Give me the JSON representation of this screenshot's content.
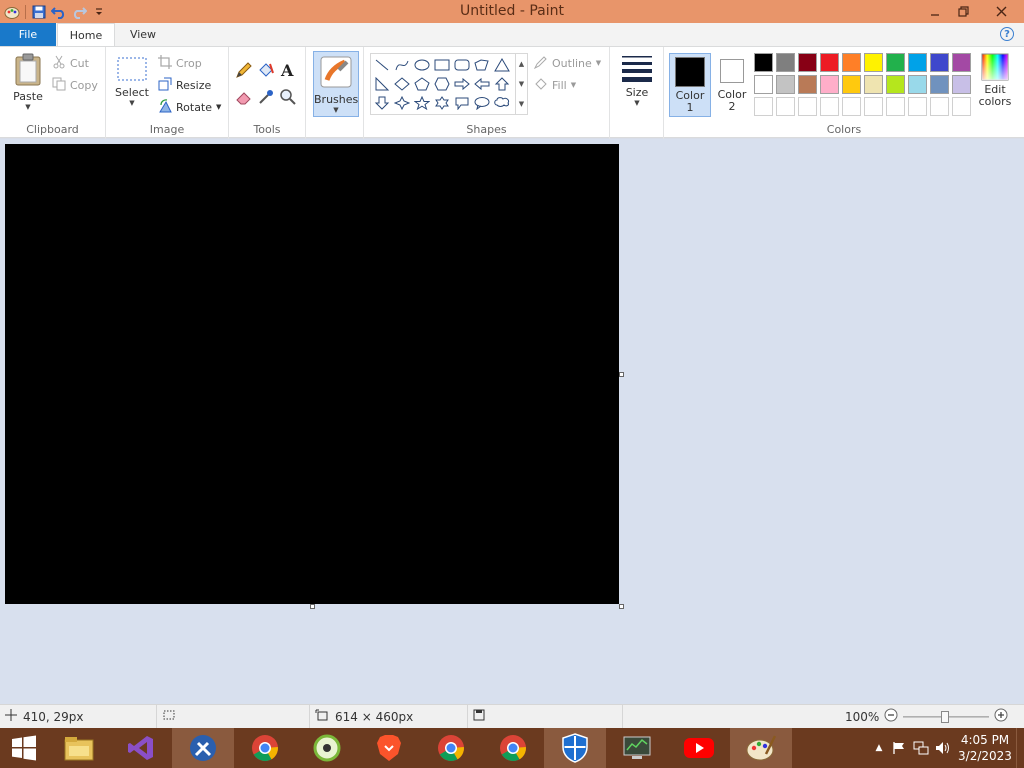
{
  "window": {
    "title": "Untitled - Paint"
  },
  "tabs": [
    {
      "label": "File"
    },
    {
      "label": "Home"
    },
    {
      "label": "View"
    }
  ],
  "help_label": "?",
  "clipboard": {
    "paste": "Paste",
    "cut": "Cut",
    "copy": "Copy",
    "group_label": "Clipboard"
  },
  "image": {
    "select": "Select",
    "crop": "Crop",
    "resize": "Resize",
    "rotate": "Rotate",
    "group_label": "Image"
  },
  "tools": {
    "group_label": "Tools"
  },
  "brushes": {
    "label": "Brushes"
  },
  "shapes": {
    "outline": "Outline",
    "fill": "Fill",
    "group_label": "Shapes"
  },
  "size": {
    "label": "Size"
  },
  "colors": {
    "color1_line1": "Color",
    "color1_line2": "1",
    "color2_line1": "Color",
    "color2_line2": "2",
    "edit_line1": "Edit",
    "edit_line2": "colors",
    "group_label": "Colors",
    "color1_value": "#000000",
    "color2_value": "#ffffff",
    "palette_row1": [
      "#000000",
      "#7f7f7f",
      "#880015",
      "#ed1c24",
      "#ff7f27",
      "#fff200",
      "#22b14c",
      "#00a2e8",
      "#3f48cc",
      "#a349a4"
    ],
    "palette_row2": [
      "#ffffff",
      "#c3c3c3",
      "#b97a57",
      "#ffaec9",
      "#ffc90e",
      "#efe4b0",
      "#b5e61d",
      "#99d9ea",
      "#7092be",
      "#c8bfe7"
    ],
    "palette_row3": [
      "#ffffff",
      "#ffffff",
      "#ffffff",
      "#ffffff",
      "#ffffff",
      "#ffffff",
      "#ffffff",
      "#ffffff",
      "#ffffff",
      "#ffffff"
    ]
  },
  "status": {
    "cursor_pos": "410, 29px",
    "image_size": "614 × 460px",
    "zoom": "100%"
  },
  "clock": {
    "time": "4:05 PM",
    "date": "3/2/2023"
  }
}
